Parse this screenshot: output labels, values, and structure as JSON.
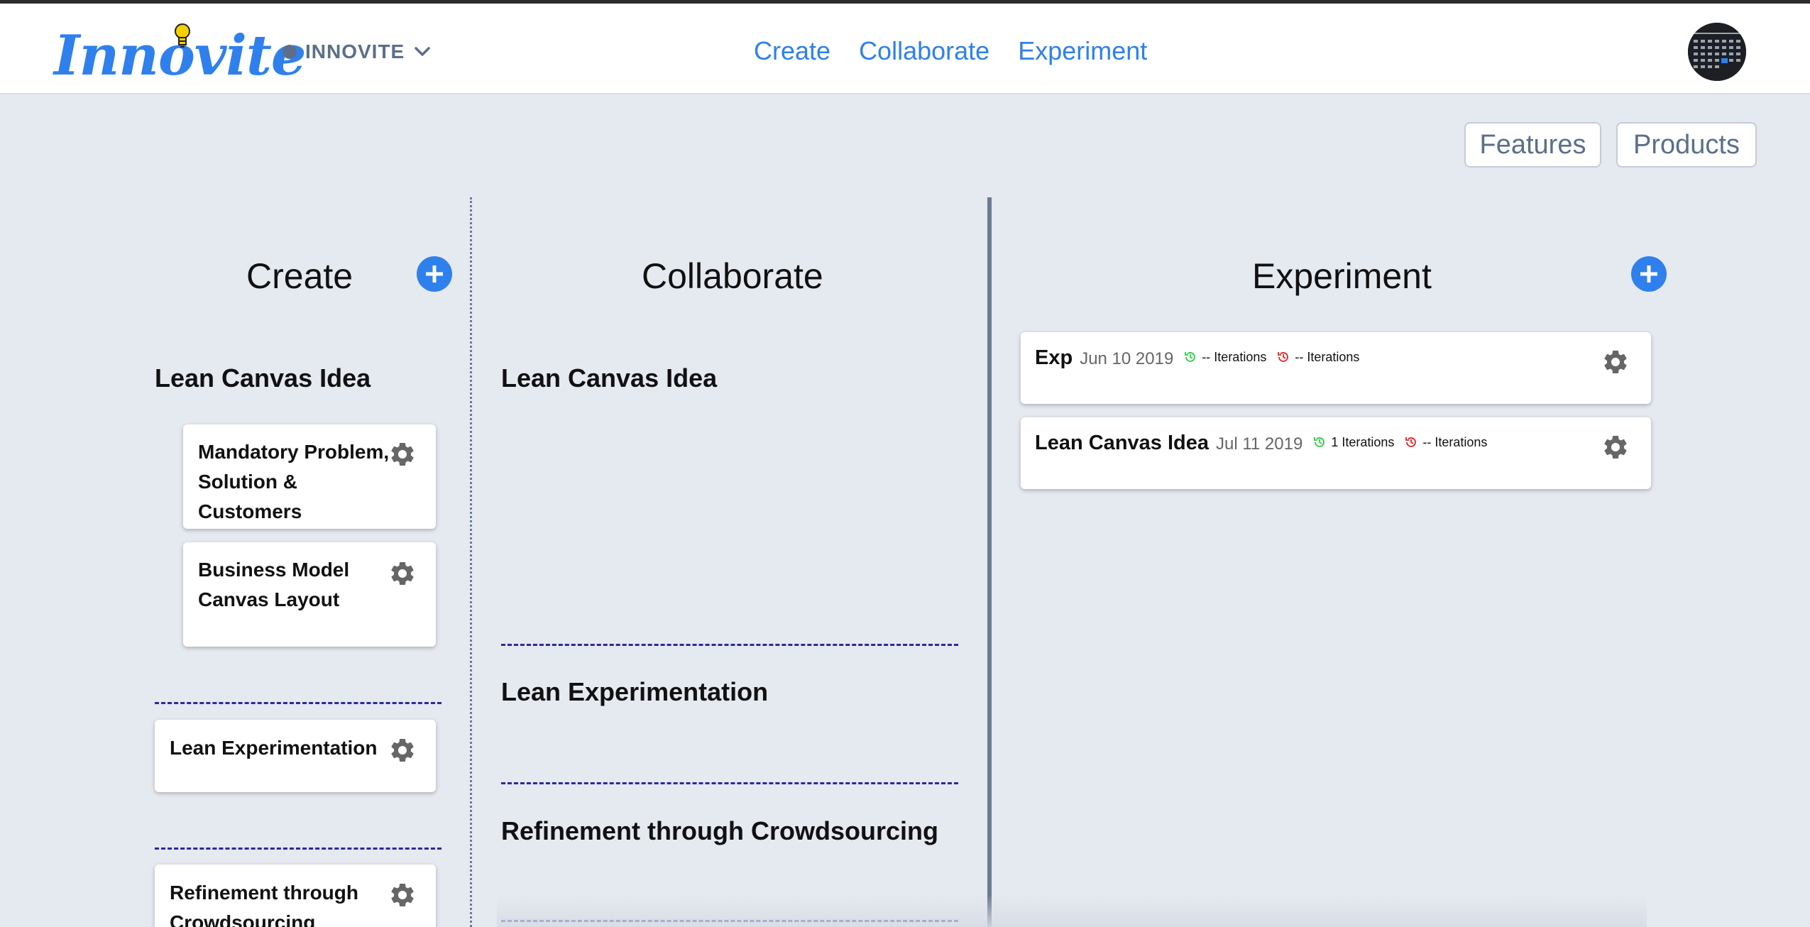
{
  "app": {
    "logo_text": "Innovite",
    "org_name": "INNOVITE"
  },
  "nav": {
    "links": [
      "Create",
      "Collaborate",
      "Experiment"
    ]
  },
  "toolbar": {
    "features_label": "Features",
    "products_label": "Products"
  },
  "colors": {
    "accent": "#2f80ed",
    "muted": "#5b6f8a",
    "dash": "#2a2aa0",
    "iter_green": "#2ecc40",
    "iter_red": "#e02424"
  },
  "create": {
    "title": "Create",
    "lean_canvas_idea": {
      "title": "Lean Canvas Idea",
      "cards": [
        "Mandatory Problem, Solution & Customers",
        "Business Model Canvas Layout"
      ]
    },
    "lean_experimentation": "Lean Experimentation",
    "refinement": "Refinement through Crowdsourcing"
  },
  "collaborate": {
    "title": "Collaborate",
    "sections": [
      "Lean Canvas Idea",
      "Lean Experimentation",
      "Refinement through Crowdsourcing"
    ]
  },
  "experiment": {
    "title": "Experiment",
    "items": [
      {
        "name": "Exp",
        "date": "Jun 10 2019",
        "green_iterations": "-- Iterations",
        "red_iterations": "-- Iterations"
      },
      {
        "name": "Lean Canvas Idea",
        "date": "Jul 11 2019",
        "green_iterations": "1 Iterations",
        "red_iterations": "-- Iterations"
      }
    ]
  }
}
